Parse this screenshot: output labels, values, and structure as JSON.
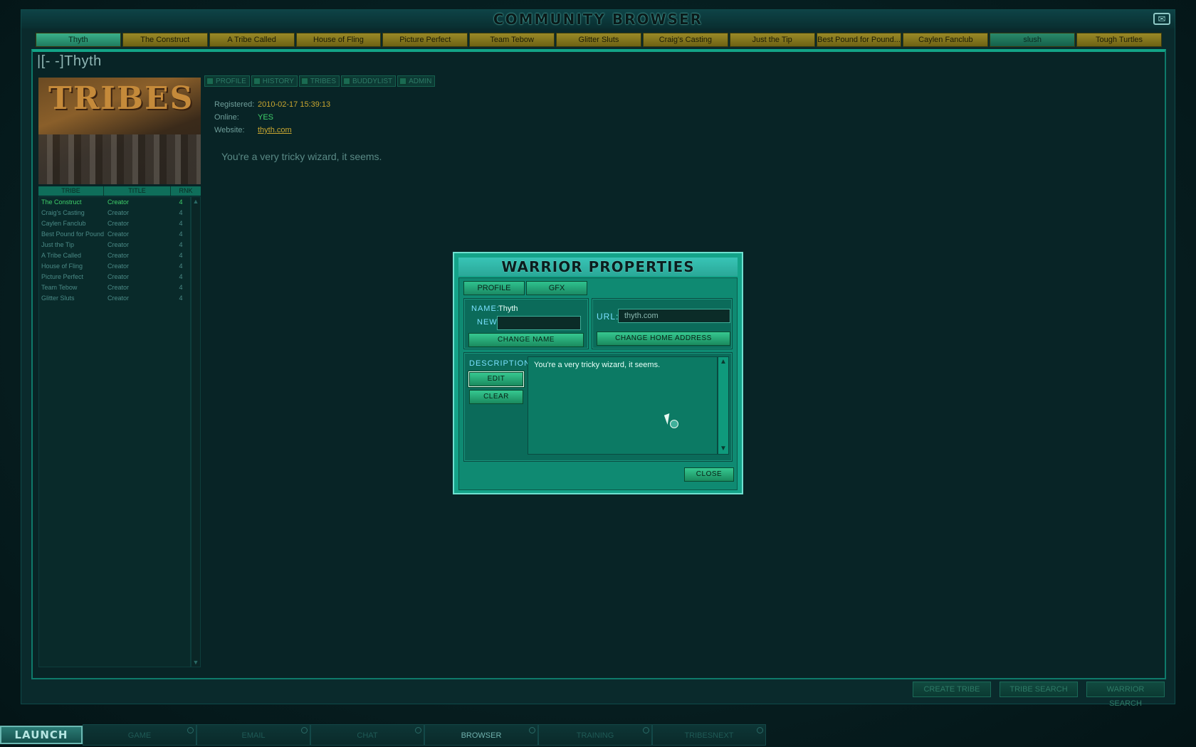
{
  "window": {
    "title": "COMMUNITY BROWSER",
    "close_glyph": "✉"
  },
  "tribe_tabs": [
    {
      "label": "Thyth",
      "style": "active"
    },
    {
      "label": "The Construct",
      "style": "gold"
    },
    {
      "label": "A Tribe Called",
      "style": "gold"
    },
    {
      "label": "House of Fling",
      "style": "gold"
    },
    {
      "label": "Picture Perfect",
      "style": "gold"
    },
    {
      "label": "Team Tebow",
      "style": "gold"
    },
    {
      "label": "Glitter Sluts",
      "style": "gold"
    },
    {
      "label": "Craig's Casting",
      "style": "gold"
    },
    {
      "label": "Just the Tip",
      "style": "gold"
    },
    {
      "label": "Best Pound for Pound...",
      "style": "gold"
    },
    {
      "label": "Caylen Fanclub",
      "style": "gold"
    },
    {
      "label": "slush",
      "style": "green"
    },
    {
      "label": "Tough Turtles",
      "style": "gold"
    }
  ],
  "profile": {
    "name": "|[-  -]Thyth",
    "portrait_logo": "TRIBES",
    "table_headers": [
      "TRIBE",
      "TITLE",
      "RNK"
    ],
    "tribes": [
      {
        "tribe": "The Construct",
        "title": "Creator",
        "rank": "4",
        "selected": true
      },
      {
        "tribe": "Craig's Casting",
        "title": "Creator",
        "rank": "4"
      },
      {
        "tribe": "Caylen Fanclub",
        "title": "Creator",
        "rank": "4"
      },
      {
        "tribe": "Best Pound for Pound",
        "title": "Creator",
        "rank": "4"
      },
      {
        "tribe": "Just the Tip",
        "title": "Creator",
        "rank": "4"
      },
      {
        "tribe": "A Tribe Called",
        "title": "Creator",
        "rank": "4"
      },
      {
        "tribe": "House of Fling",
        "title": "Creator",
        "rank": "4"
      },
      {
        "tribe": "Picture Perfect",
        "title": "Creator",
        "rank": "4"
      },
      {
        "tribe": "Team Tebow",
        "title": "Creator",
        "rank": "4"
      },
      {
        "tribe": "Glitter Sluts",
        "title": "Creator",
        "rank": "4"
      }
    ],
    "subtabs": [
      "PROFILE",
      "HISTORY",
      "TRIBES",
      "BUDDYLIST",
      "ADMIN"
    ],
    "registered_label": "Registered:",
    "registered_value": "2010-02-17 15:39:13",
    "online_label": "Online:",
    "online_value": "YES",
    "website_label": "Website:",
    "website_value": "thyth.com",
    "motto": "You're a very tricky wizard, it seems."
  },
  "bottom_buttons": [
    "CREATE TRIBE",
    "TRIBE SEARCH",
    "WARRIOR SEARCH"
  ],
  "taskbar": {
    "launch": "LAUNCH",
    "items": [
      "GAME",
      "EMAIL",
      "CHAT",
      "BROWSER",
      "TRAINING",
      "TRIBESNEXT"
    ],
    "active": "BROWSER"
  },
  "dialog": {
    "title": "WARRIOR PROPERTIES",
    "tabs": [
      "PROFILE",
      "GFX"
    ],
    "name_label": "NAME:",
    "name_value": "Thyth",
    "new_label": "NEW:",
    "new_value": "",
    "change_name": "CHANGE NAME",
    "url_label": "URL:",
    "url_value": "thyth.com",
    "change_home": "CHANGE HOME ADDRESS",
    "description_label": "DESCRIPTION:",
    "edit": "EDIT",
    "clear": "CLEAR",
    "description_text": "You're a very tricky wizard, it seems.",
    "close": "CLOSE"
  }
}
